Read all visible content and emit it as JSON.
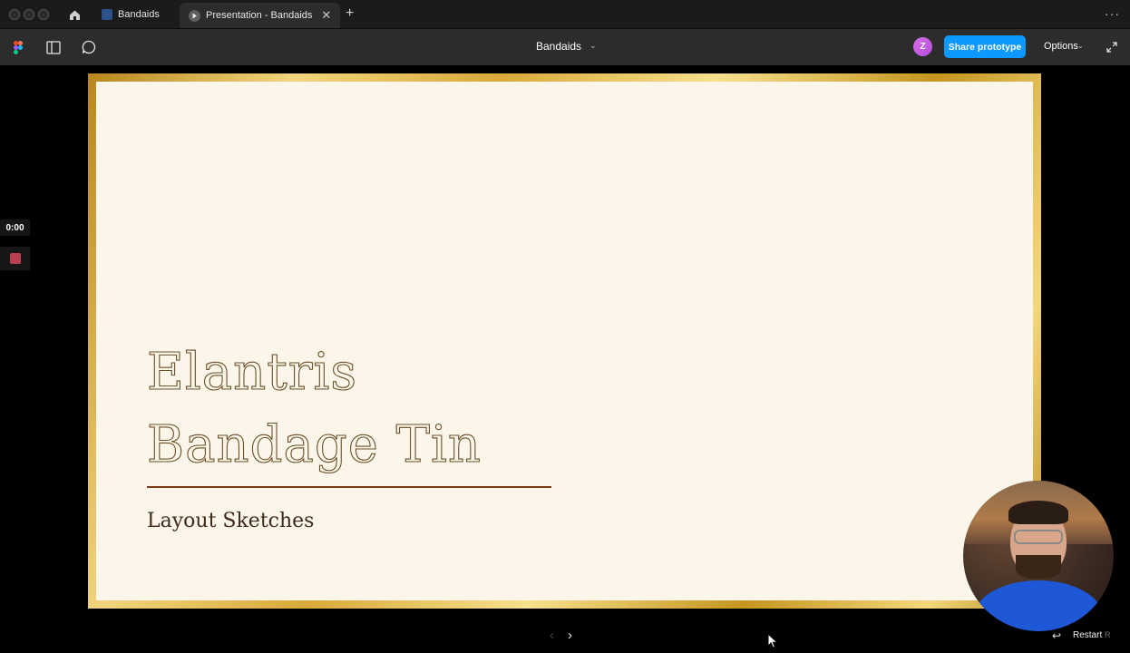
{
  "tabs": {
    "items": [
      {
        "label": "Bandaids"
      },
      {
        "label": "Presentation - Bandaids"
      }
    ],
    "close_glyph": "✕",
    "new_tab_glyph": "+",
    "more_glyph": "···"
  },
  "toolbar": {
    "file_name": "Bandaids",
    "avatar_initial": "Z",
    "share_label": "Share prototype",
    "options_label": "Options"
  },
  "recorder": {
    "time": "0:00"
  },
  "slide": {
    "title_line1": "Elantris",
    "title_line2": "Bandage Tin",
    "subtitle": "Layout Sketches"
  },
  "nav": {
    "prev_glyph": "‹",
    "next_glyph": "›",
    "restart_label": "Restart",
    "restart_key": "R"
  },
  "colors": {
    "accent": "#0d99ff",
    "slide_bg": "#fbf6e9",
    "gold": "#d9a93a",
    "rule": "#7a3b14",
    "recorder_stop": "#b8414f"
  }
}
